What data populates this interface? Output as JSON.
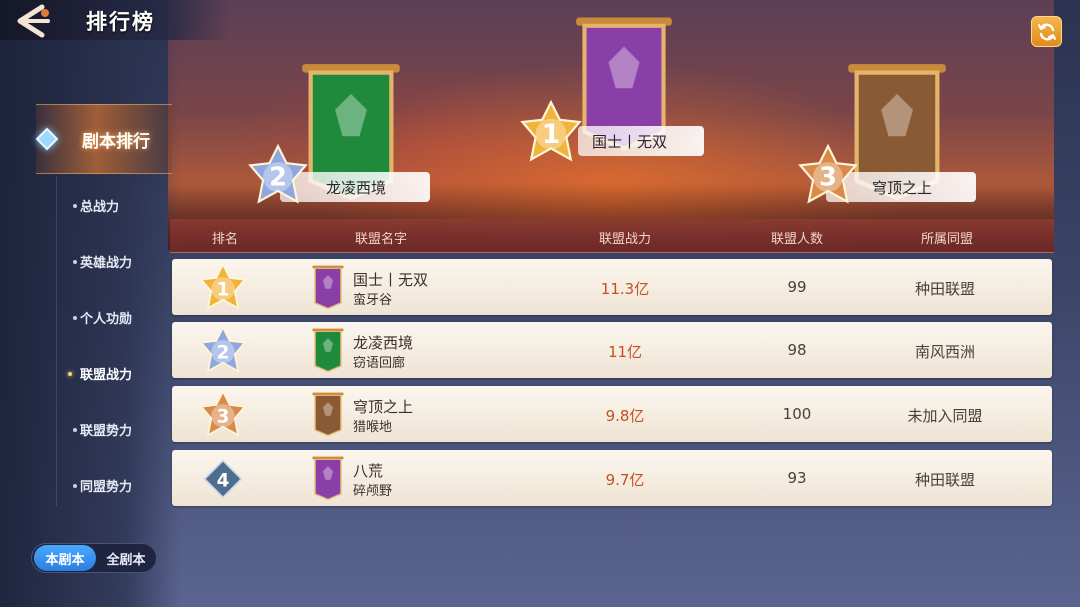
{
  "header": {
    "title": "排行榜"
  },
  "nav": {
    "active_label": "剧本排行",
    "items": [
      {
        "label": "总战力"
      },
      {
        "label": "英雄战力"
      },
      {
        "label": "个人功勋"
      },
      {
        "label": "联盟战力"
      },
      {
        "label": "联盟势力"
      },
      {
        "label": "同盟势力"
      }
    ],
    "selected_index": 3
  },
  "toggle": {
    "on_label": "本剧本",
    "off_label": "全剧本"
  },
  "podium": [
    {
      "rank": "1",
      "name": "国士丨无双",
      "banner_color": "#8a3fa8"
    },
    {
      "rank": "2",
      "name": "龙凌西境",
      "banner_color": "#1f8a3c"
    },
    {
      "rank": "3",
      "name": "穹顶之上",
      "banner_color": "#8a5a34"
    }
  ],
  "table": {
    "headers": {
      "rank": "排名",
      "name": "联盟名字",
      "power": "联盟战力",
      "members": "联盟人数",
      "league": "所属同盟"
    },
    "rows": [
      {
        "rank": "1",
        "name": "国士丨无双",
        "region": "蛮牙谷",
        "power": "11.3亿",
        "members": "99",
        "league": "种田联盟",
        "banner_color": "#8a3fa8"
      },
      {
        "rank": "2",
        "name": "龙凌西境",
        "region": "窃语回廊",
        "power": "11亿",
        "members": "98",
        "league": "南风西洲",
        "banner_color": "#1f8a3c"
      },
      {
        "rank": "3",
        "name": "穹顶之上",
        "region": "猎喉地",
        "power": "9.8亿",
        "members": "100",
        "league": "未加入同盟",
        "banner_color": "#8a5a34"
      },
      {
        "rank": "4",
        "name": "八荒",
        "region": "碎颅野",
        "power": "9.7亿",
        "members": "93",
        "league": "种田联盟",
        "banner_color": "#8a3fa8"
      }
    ]
  },
  "colors": {
    "gold": "#f2b33a",
    "silver": "#8fa6e0",
    "bronze": "#d98a4a",
    "plain": "#4f6e8f"
  },
  "icons": {
    "back": "back-arrow-icon",
    "refresh": "refresh-icon"
  }
}
